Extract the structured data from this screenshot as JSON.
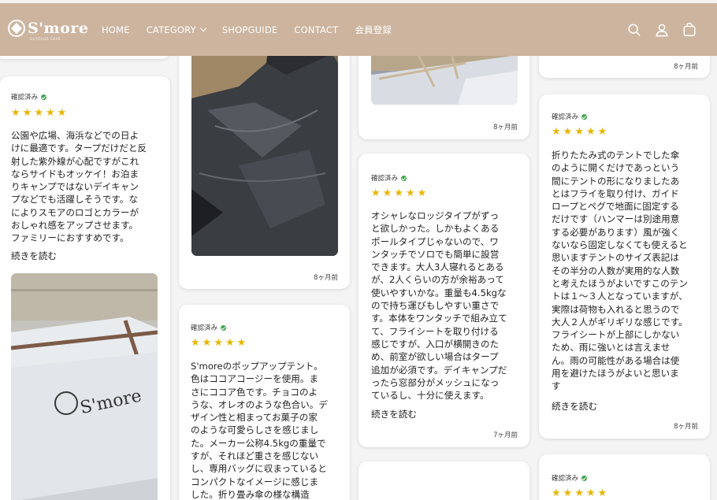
{
  "header": {
    "logo_text": "S'more",
    "logo_sub": "OUTDOOR GEAR",
    "nav": [
      {
        "label": "HOME"
      },
      {
        "label": "CATEGORY"
      },
      {
        "label": "SHOPGUIDE"
      },
      {
        "label": "CONTACT"
      },
      {
        "label": "会員登録"
      }
    ],
    "icons": [
      "search-icon",
      "account-icon",
      "cart-icon"
    ]
  },
  "reviews": {
    "col1": {
      "card1": {
        "verified": "確認済み",
        "rating": 5,
        "text": "公園や広場、海浜などでの日よ\nけに最適です。タープだけだと反\n射した紫外線が心配ですがこれ\nならサイドもオッケイ！お泊ま\nりキャンプではないデイキャン\nプなどでも活躍しそうです。な\nによりスモアのロゴとカラーが\nおしゃれ感をアップさせます。\nファミリーにおすすめです。",
        "read_more": "続きを読む"
      }
    },
    "col2": {
      "card1": {
        "date": "8ヶ月前"
      },
      "card2": {
        "verified": "確認済み",
        "rating": 5,
        "text": "S'moreのポップアップテント。\n色はココアコージーを使用。ま\nさにココア色です。チョコのよ\nうな、オレオのような色合い。デ\nザイン性と相まってお菓子の家\nのような可愛らしさを感じまし\nた。メーカー公称4.5kgの重量で\nすが、それほど重さを感じない\nし、専用バッグに収まっていると\nコンパクトなイメージに感じま\nした。折り畳み傘の様な構造"
      }
    },
    "col3": {
      "card1": {
        "date": "8ヶ月前"
      },
      "card2": {
        "verified": "確認済み",
        "rating": 5,
        "text": "オシャレなロッジタイプがずっ\nと欲しかった。しかもよくある\nポールタイプじゃないので、ワ\nンタッチでソロでも簡単に設営\nできます。大人3人寝れるとある\nが、2人くらいの方が余裕あって\n使いやすいかな。重量も4.5kgな\nので持ち運びもしやすい重さで\nす。本体をワンタッチで組み立て\nて、フライシートを取り付ける\n感じですが、入口が横開きのた\nめ、前室が欲しい場合はタープ\n追加が必須です。デイキャンプだ\nったら窓部分がメッシュになっ\nているし、十分に使えます。",
        "read_more": "続きを読む",
        "date": "7ヶ月前"
      }
    },
    "col4": {
      "card1": {
        "date": "8ヶ月前"
      },
      "card2": {
        "verified": "確認済み",
        "rating": 5,
        "text": "折りたたみ式のテントでした傘\nのように開くだけであっという\n間にテントの形になりましたあ\nとはフライを取り付け、ガイド\nロープとペグで地面に固定する\nだけです（ハンマーは別途用意\nする必要があります）風が強く\nないなら固定しなくても使えると\n思いますテントのサイズ表記は\nその半分の人数が実用的な人数\nと考えたほうがよいですこのテン\nトは１～３人となっていますが、\n実際は荷物も入れると思うので\n大人２人がギリギリな感じです。\nフライシートが上部にしかない\nため、雨に強いとは言えませ\nん。雨の可能性がある場合は使\n用を避けたほうがよいと思いま\nす",
        "read_more": "続きを読む",
        "date": "8ヶ月前"
      },
      "card3": {
        "verified": "確認済み",
        "rating": 5
      }
    }
  },
  "photo_text": {
    "bag_logo": "S'more"
  },
  "colors": {
    "header_bg": "#ccb49e",
    "star": "#e5b600",
    "verified": "#3fa34d"
  }
}
